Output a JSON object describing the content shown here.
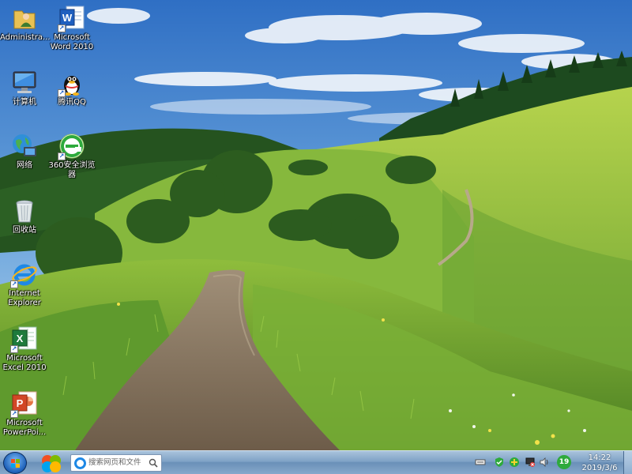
{
  "desktop": {
    "icons": [
      {
        "label": "Administra..."
      },
      {
        "label": "Microsoft Word 2010"
      },
      {
        "label": "计算机"
      },
      {
        "label": "腾讯QQ"
      },
      {
        "label": "网络"
      },
      {
        "label": "360安全浏览器"
      },
      {
        "label": "回收站"
      },
      {
        "label": "Internet Explorer"
      },
      {
        "label": "Microsoft Excel 2010"
      },
      {
        "label": "Microsoft PowerPoi..."
      }
    ]
  },
  "taskbar": {
    "search_placeholder": "搜索网页和文件",
    "tray_badge": "19",
    "clock_time": "14:22",
    "clock_date": "2019/3/6"
  },
  "icons": {
    "start": "windows-start-orb",
    "pinned": "windows-live-icon",
    "search_engine": "ie-e-icon",
    "search": "magnifier-icon"
  },
  "colors": {
    "taskbar": "#7fa2c6",
    "sky": "#3d7fcf",
    "grass": "#7fb33a"
  }
}
